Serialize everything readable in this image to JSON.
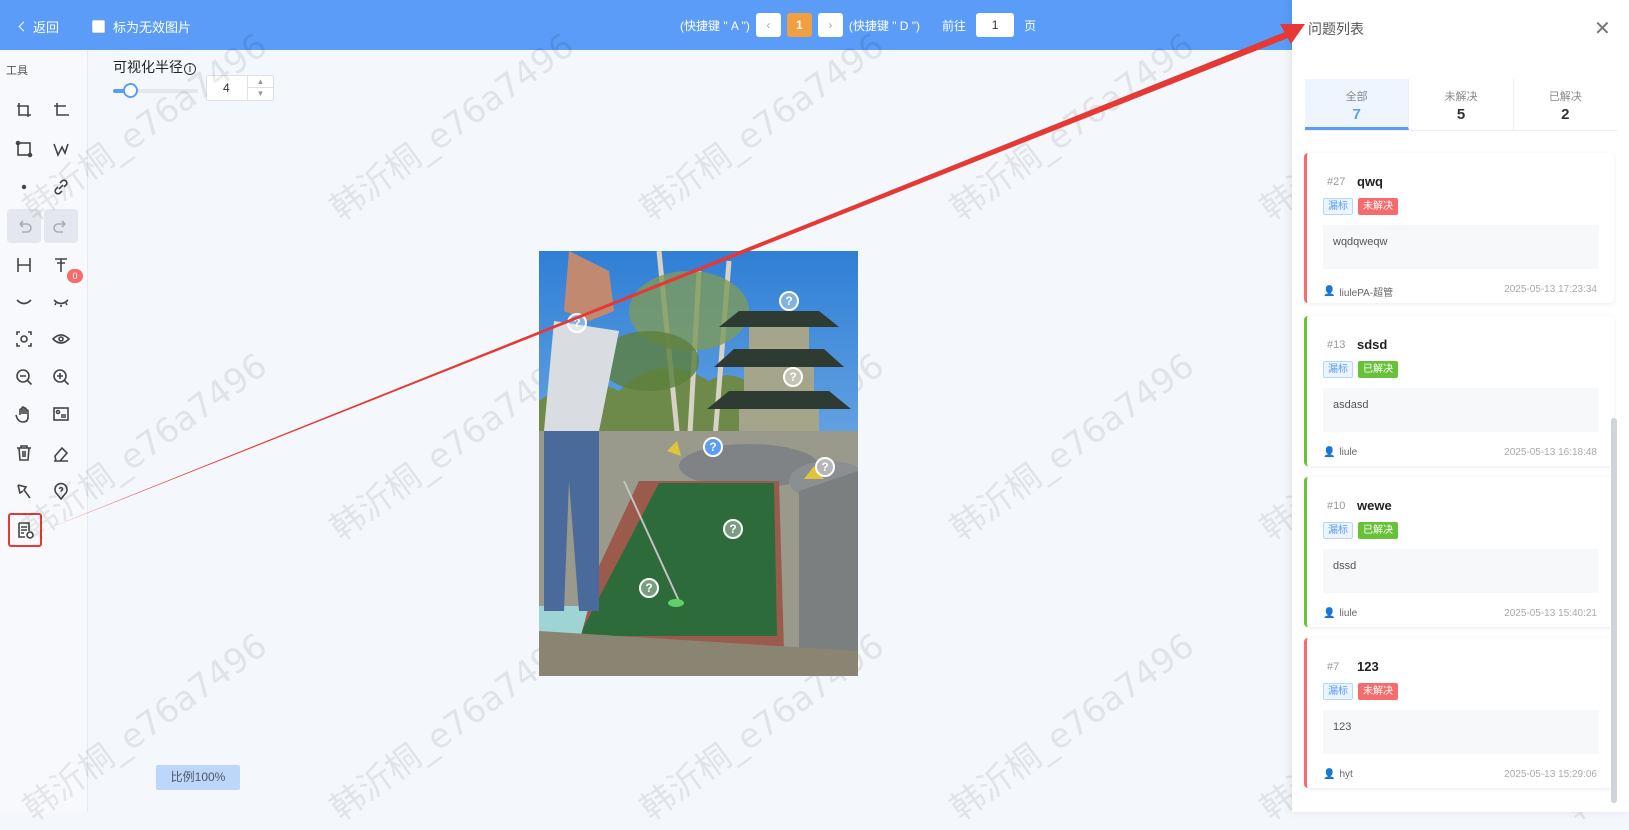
{
  "topbar": {
    "back_label": "返回",
    "invalid_label": "标为无效图片",
    "prev_hint": "(快捷键 \" A \")",
    "current_page": "1",
    "next_hint": "(快捷键 \" D \")",
    "goto_label": "前往",
    "goto_value": "1",
    "page_suffix": "页"
  },
  "sidebar": {
    "tools_label": "工具",
    "icons": [
      "crop-icon",
      "rectangle-select-icon",
      "bounding-box-icon",
      "polyline-icon",
      "point-icon",
      "link-icon",
      "undo-icon",
      "redo-icon",
      "h-align-icon",
      "text-icon",
      "eye-closed-icon",
      "eye-lashes-icon",
      "focus-icon",
      "eye-icon",
      "zoom-out-icon",
      "zoom-in-icon",
      "hand-icon",
      "image-icon",
      "trash-icon",
      "eraser-icon",
      "key-icon",
      "question-marker-icon",
      "issue-list-icon"
    ],
    "visibility_badge": "0"
  },
  "options": {
    "radius_label": "可视化半径",
    "radius_value": "4",
    "radius_level": 0.2
  },
  "canvas": {
    "ratio_label": "比例100%"
  },
  "watermark": "韩沂桐_e76a7496",
  "panel": {
    "title": "问题列表",
    "stats": [
      {
        "label": "全部",
        "count": "7"
      },
      {
        "label": "未解决",
        "count": "5"
      },
      {
        "label": "已解决",
        "count": "2"
      }
    ],
    "issues": [
      {
        "id": "#27",
        "title": "qwq",
        "type": "漏标",
        "status": "未解决",
        "desc": "wqdqweqw",
        "user": "liulePA-超管",
        "time": "2025-05-13 17:23:34"
      },
      {
        "id": "#13",
        "title": "sdsd",
        "type": "漏标",
        "status": "已解决",
        "desc": "asdasd",
        "user": "liule",
        "time": "2025-05-13 16:18:48"
      },
      {
        "id": "#10",
        "title": "wewe",
        "type": "漏标",
        "status": "已解决",
        "desc": "dssd",
        "user": "liule",
        "time": "2025-05-13 15:40:21"
      },
      {
        "id": "#7",
        "title": "123",
        "type": "漏标",
        "status": "未解决",
        "desc": "123",
        "user": "hyt",
        "time": "2025-05-13 15:29:06"
      }
    ]
  },
  "colors": {
    "topbar": "#5a9cf8",
    "active_page": "#f0a040",
    "unresolved": "#f56c6c",
    "resolved": "#67c23a",
    "annotation_arrow": "#e53935"
  }
}
